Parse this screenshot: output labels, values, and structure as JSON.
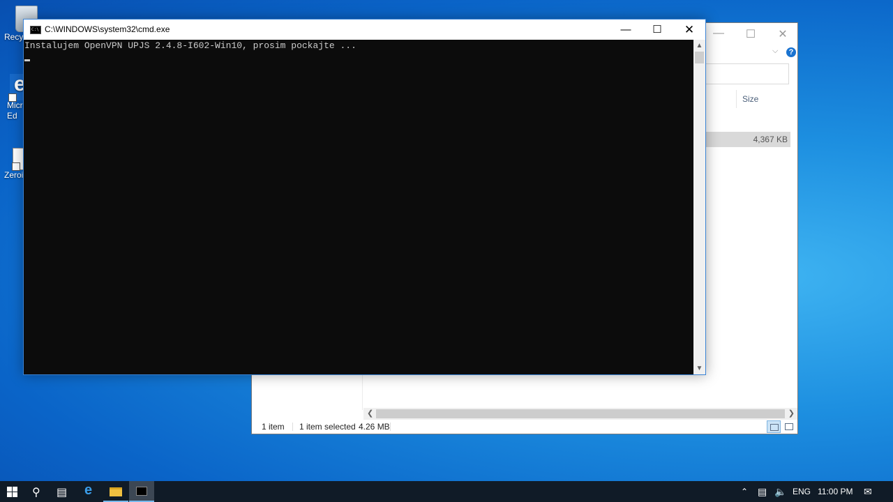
{
  "desktop": {
    "icons": [
      {
        "label": "Recy"
      },
      {
        "label": "Micr\nEd"
      },
      {
        "label": "Zeroi"
      }
    ]
  },
  "explorer": {
    "column_size": "Size",
    "file_size": "4,367 KB",
    "status_items": "1 item",
    "status_selected": "1 item selected",
    "status_size": "4.26 MB",
    "minimize": "—",
    "maximize": "☐",
    "close": "✕",
    "help": "?"
  },
  "cmd": {
    "title": "C:\\WINDOWS\\system32\\cmd.exe",
    "output_line": "Instalujem OpenVPN UPJS 2.4.8-I602-Win10, prosim pockajte ...",
    "minimize": "—",
    "maximize": "☐",
    "close": "✕"
  },
  "taskbar": {
    "language": "ENG",
    "time": "11:00 PM"
  },
  "colors": {
    "console_bg": "#0c0c0c",
    "console_text": "#cccccc",
    "taskbar_bg": "#101b27",
    "accent": "#76b9ed"
  }
}
